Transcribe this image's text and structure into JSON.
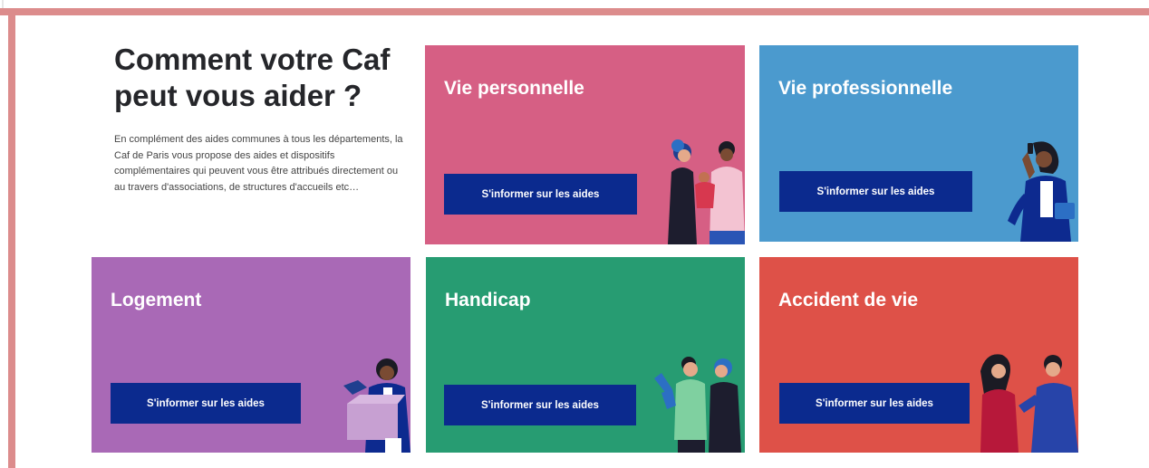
{
  "intro": {
    "title_line1": "Comment votre Caf",
    "title_line2": "peut vous aider ?",
    "paragraph": "En complément des aides communes à tous les départements, la Caf de Paris vous propose des aides et dispositifs complémentaires qui peuvent vous être attribués directement ou au travers d'associations, de structures d'accueils etc…"
  },
  "cards": [
    {
      "title": "Vie personnelle",
      "button": "S'informer sur les aides",
      "color": "#d65f84",
      "illustration": "family-illustration"
    },
    {
      "title": "Vie professionnelle",
      "button": "S'informer sur les aides",
      "color": "#4b9ace",
      "illustration": "worker-phone-illustration"
    },
    {
      "title": "Logement",
      "button": "S'informer sur les aides",
      "color": "#a969b6",
      "illustration": "moving-box-illustration"
    },
    {
      "title": "Handicap",
      "button": "S'informer sur les aides",
      "color": "#279c72",
      "illustration": "couple-illustration"
    },
    {
      "title": "Accident de vie",
      "button": "S'informer sur les aides",
      "color": "#de5148",
      "illustration": "comforting-illustration"
    }
  ],
  "theme": {
    "frame_color": "#dc8c8c",
    "button_color": "#0b2a8e"
  }
}
